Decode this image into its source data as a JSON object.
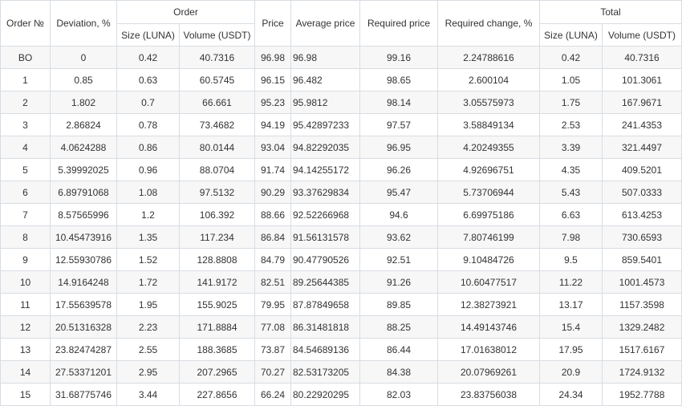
{
  "headers": {
    "order_no": "Order №",
    "deviation": "Deviation, %",
    "order_group": "Order",
    "size": "Size (LUNA)",
    "volume": "Volume (USDT)",
    "price": "Price",
    "avg_price": "Average price",
    "req_price": "Required price",
    "req_change": "Required change, %",
    "total_group": "Total",
    "total_size": "Size (LUNA)",
    "total_volume": "Volume (USDT)"
  },
  "rows": [
    [
      "BO",
      "0",
      "0.42",
      "40.7316",
      "96.98",
      "96.98",
      "99.16",
      "2.24788616",
      "0.42",
      "40.7316"
    ],
    [
      "1",
      "0.85",
      "0.63",
      "60.5745",
      "96.15",
      "96.482",
      "98.65",
      "2.600104",
      "1.05",
      "101.3061"
    ],
    [
      "2",
      "1.802",
      "0.7",
      "66.661",
      "95.23",
      "95.9812",
      "98.14",
      "3.05575973",
      "1.75",
      "167.9671"
    ],
    [
      "3",
      "2.86824",
      "0.78",
      "73.4682",
      "94.19",
      "95.42897233",
      "97.57",
      "3.58849134",
      "2.53",
      "241.4353"
    ],
    [
      "4",
      "4.0624288",
      "0.86",
      "80.0144",
      "93.04",
      "94.82292035",
      "96.95",
      "4.20249355",
      "3.39",
      "321.4497"
    ],
    [
      "5",
      "5.39992025",
      "0.96",
      "88.0704",
      "91.74",
      "94.14255172",
      "96.26",
      "4.92696751",
      "4.35",
      "409.5201"
    ],
    [
      "6",
      "6.89791068",
      "1.08",
      "97.5132",
      "90.29",
      "93.37629834",
      "95.47",
      "5.73706944",
      "5.43",
      "507.0333"
    ],
    [
      "7",
      "8.57565996",
      "1.2",
      "106.392",
      "88.66",
      "92.52266968",
      "94.6",
      "6.69975186",
      "6.63",
      "613.4253"
    ],
    [
      "8",
      "10.45473916",
      "1.35",
      "117.234",
      "86.84",
      "91.56131578",
      "93.62",
      "7.80746199",
      "7.98",
      "730.6593"
    ],
    [
      "9",
      "12.55930786",
      "1.52",
      "128.8808",
      "84.79",
      "90.47790526",
      "92.51",
      "9.10484726",
      "9.5",
      "859.5401"
    ],
    [
      "10",
      "14.9164248",
      "1.72",
      "141.9172",
      "82.51",
      "89.25644385",
      "91.26",
      "10.60477517",
      "11.22",
      "1001.4573"
    ],
    [
      "11",
      "17.55639578",
      "1.95",
      "155.9025",
      "79.95",
      "87.87849658",
      "89.85",
      "12.38273921",
      "13.17",
      "1157.3598"
    ],
    [
      "12",
      "20.51316328",
      "2.23",
      "171.8884",
      "77.08",
      "86.31481818",
      "88.25",
      "14.49143746",
      "15.4",
      "1329.2482"
    ],
    [
      "13",
      "23.82474287",
      "2.55",
      "188.3685",
      "73.87",
      "84.54689136",
      "86.44",
      "17.01638012",
      "17.95",
      "1517.6167"
    ],
    [
      "14",
      "27.53371201",
      "2.95",
      "207.2965",
      "70.27",
      "82.53173205",
      "84.38",
      "20.07969261",
      "20.9",
      "1724.9132"
    ],
    [
      "15",
      "31.68775746",
      "3.44",
      "227.8656",
      "66.24",
      "80.22920295",
      "82.03",
      "23.83756038",
      "24.34",
      "1952.7788"
    ]
  ]
}
